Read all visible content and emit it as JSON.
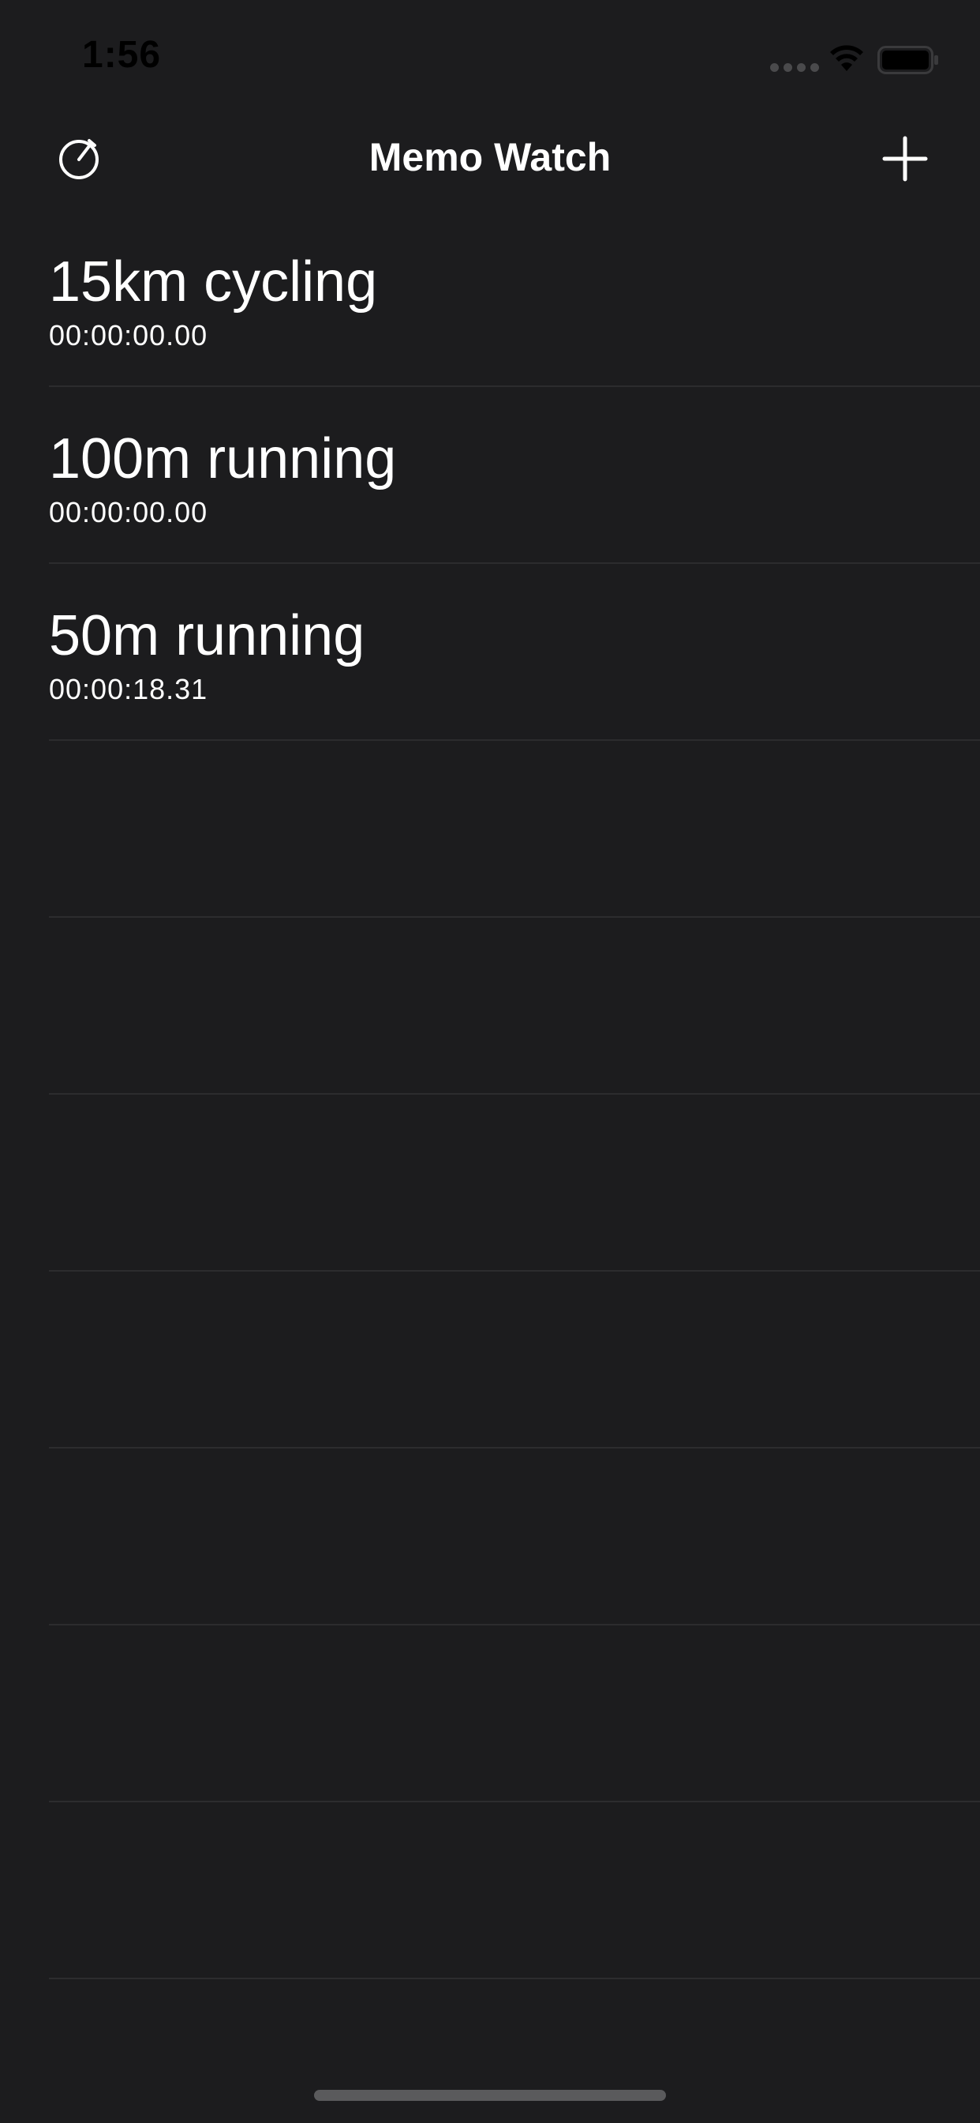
{
  "status_bar": {
    "time": "1:56",
    "icons": [
      "signal-icon",
      "wifi-icon",
      "battery-icon"
    ]
  },
  "nav": {
    "title": "Memo Watch",
    "left_icon": "stopwatch-icon",
    "right_icon": "plus-icon"
  },
  "memos": [
    {
      "title": "15km cycling",
      "time": "00:00:00.00"
    },
    {
      "title": "100m running",
      "time": "00:00:00.00"
    },
    {
      "title": "50m running",
      "time": "00:00:18.31"
    }
  ],
  "colors": {
    "background": "#1c1c1e",
    "separator": "#2c2c2e",
    "text": "#ffffff"
  }
}
